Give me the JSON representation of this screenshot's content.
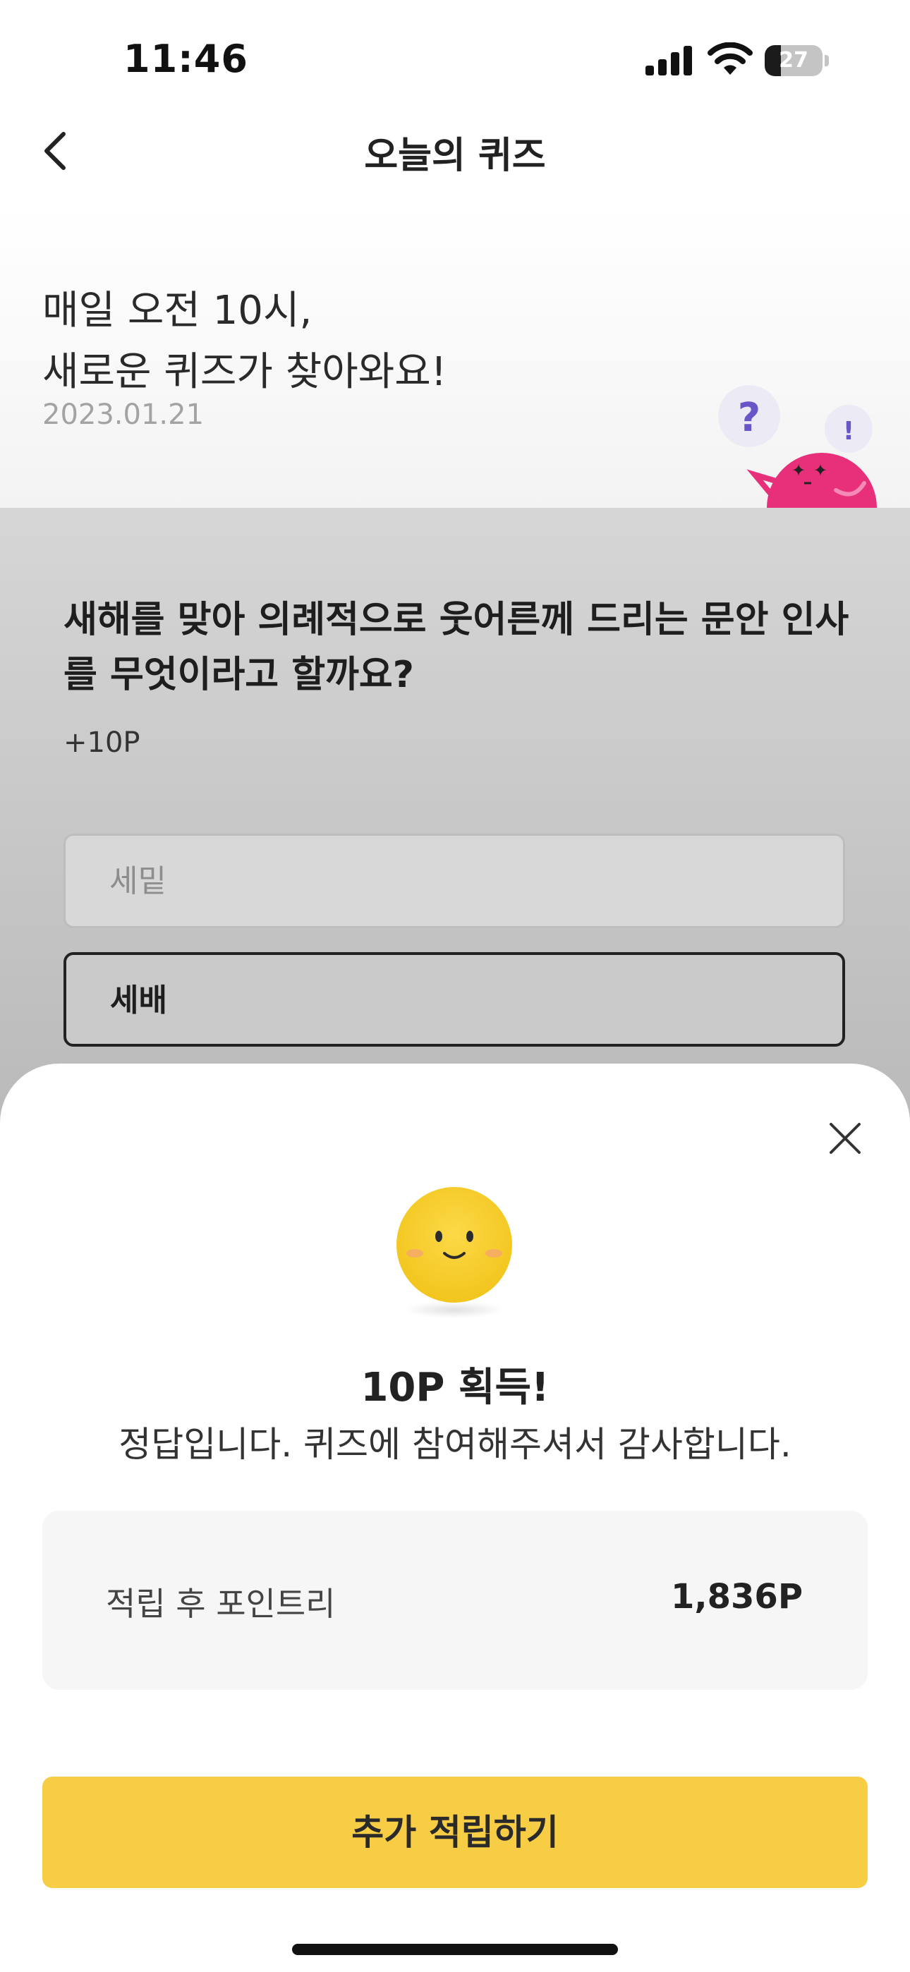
{
  "status_bar": {
    "time": "11:46",
    "battery_level": "27",
    "icons": [
      "signal-icon",
      "wifi-icon",
      "battery-icon"
    ]
  },
  "nav": {
    "title": "오늘의 퀴즈",
    "back_icon": "chevron-left-icon"
  },
  "hero": {
    "line1": "매일 오전 10시,",
    "line2": "새로운 퀴즈가 찾아와요!",
    "date": "2023.01.21"
  },
  "quiz": {
    "question": "새해를 맞아 의례적으로 웃어른께 드리는 문안 인사를 무엇이라고 할까요?",
    "points": "+10P",
    "options": [
      {
        "label": "세밑",
        "selected": false
      },
      {
        "label": "세배",
        "selected": true
      }
    ]
  },
  "result_sheet": {
    "title": "10P 획득!",
    "subtitle": "정답입니다. 퀴즈에 참여해주셔서 감사합니다.",
    "balance_label": "적립 후 포인트리",
    "balance_value": "1,836P",
    "cta_label": "추가 적립하기",
    "close_icon": "close-icon"
  },
  "colors": {
    "accent": "#f6cd45",
    "mascot_pink": "#e8307a",
    "dim_overlay": "#c8c8c8"
  }
}
